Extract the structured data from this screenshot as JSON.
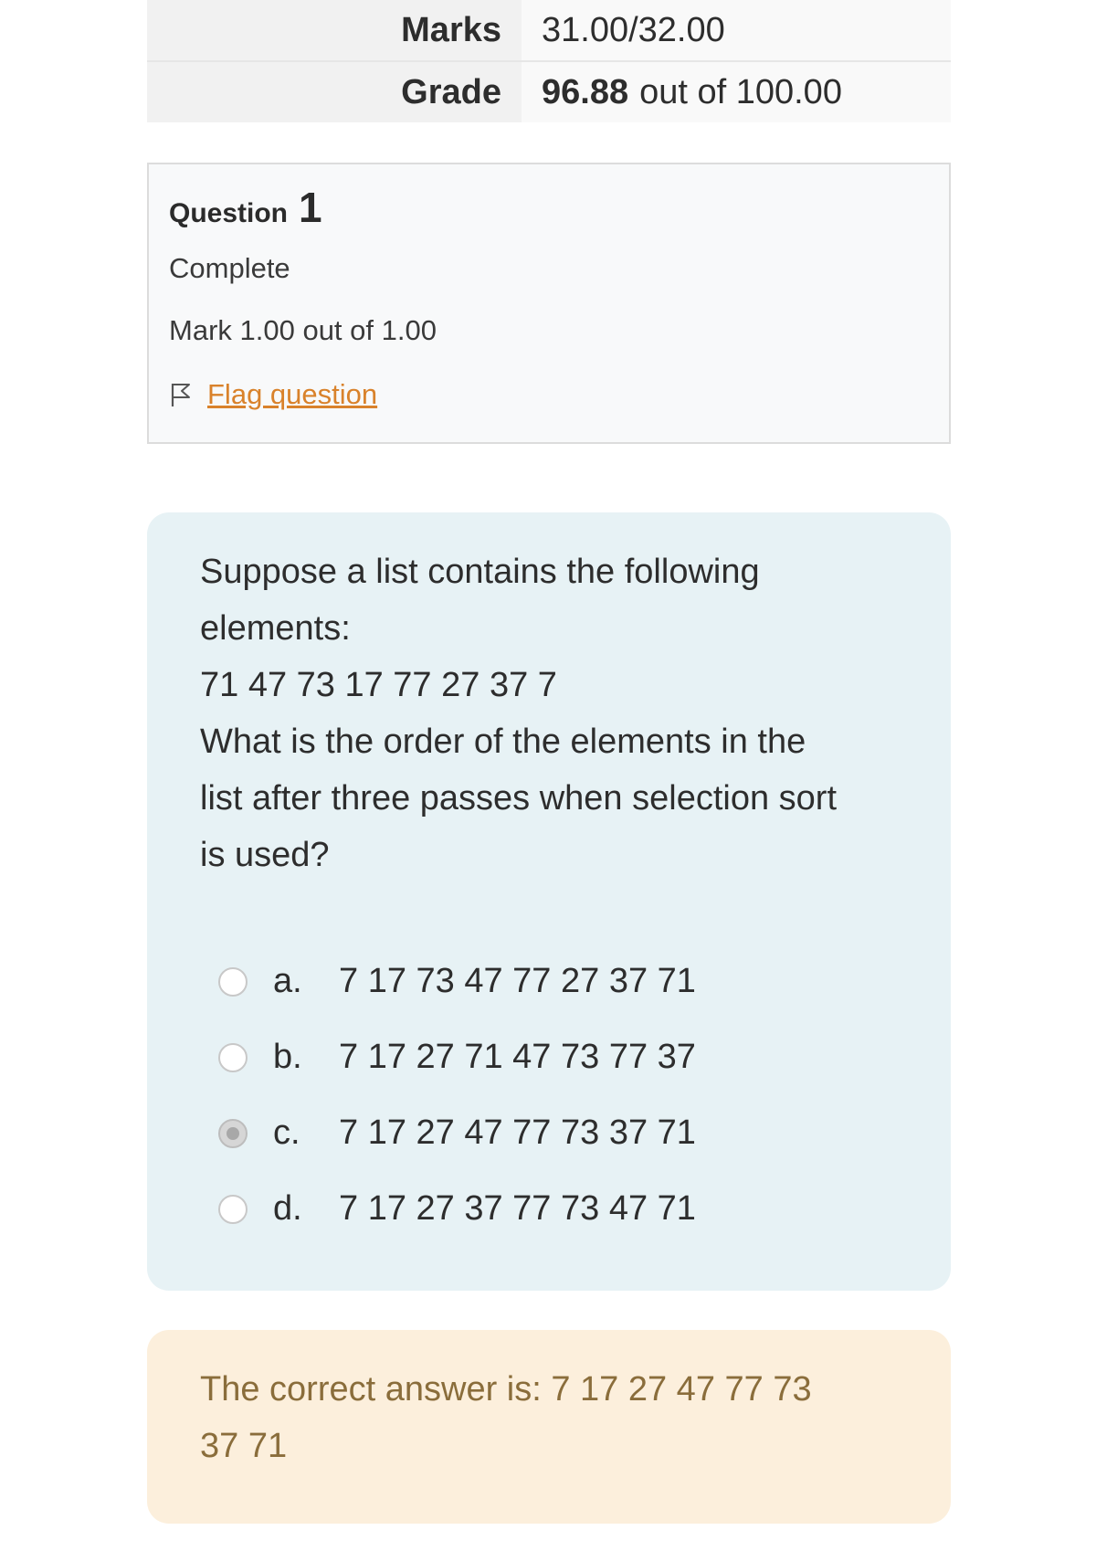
{
  "summary": {
    "marks_label": "Marks",
    "marks_value": "31.00/32.00",
    "grade_label": "Grade",
    "grade_score": "96.88",
    "grade_suffix": "out of 100.00"
  },
  "question": {
    "label": "Question",
    "number": "1",
    "state": "Complete",
    "grade": "Mark 1.00 out of 1.00",
    "flag_label": "Flag question",
    "text_lines": [
      "Suppose a list contains the following",
      "elements:",
      "71 47 73 17 77 27 37 7",
      "What is the order of the elements in the",
      "list after three passes when selection sort",
      "is used?"
    ],
    "answers": [
      {
        "letter": "a.",
        "text": "7 17 73 47 77 27 37 71",
        "selected": false
      },
      {
        "letter": "b.",
        "text": "7 17 27 71 47 73 77 37",
        "selected": false
      },
      {
        "letter": "c.",
        "text": "7 17 27 47 77 73 37 71",
        "selected": true
      },
      {
        "letter": "d.",
        "text": "7 17 27 37 77 73 47 71",
        "selected": false
      }
    ]
  },
  "feedback": {
    "line1": "The correct answer is: 7 17 27 47 77 73",
    "line2": "37 71"
  },
  "colors": {
    "link": "#d9822b",
    "formulation_bg": "#e7f2f5",
    "feedback_bg": "#fcefdc",
    "feedback_text": "#8a6d3b"
  }
}
